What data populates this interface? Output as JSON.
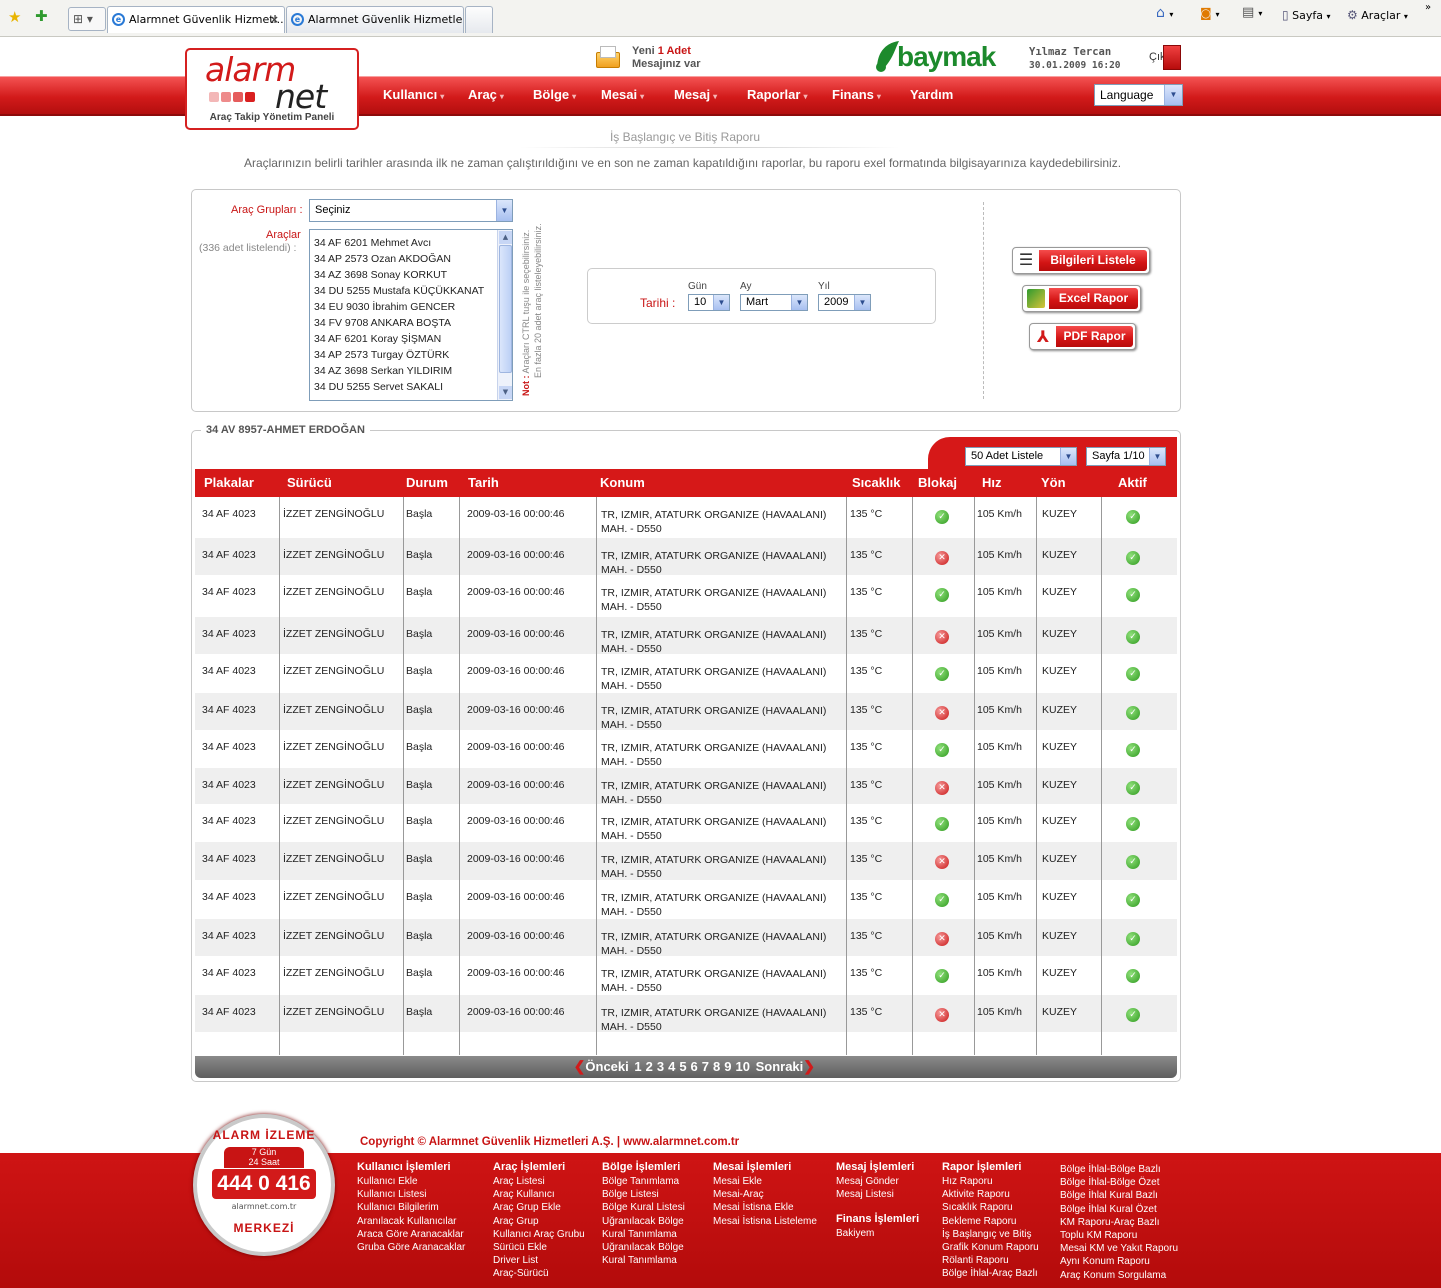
{
  "browser": {
    "tabs": [
      "Alarmnet Güvenlik Hizmetl...",
      "Alarmnet Güvenlik Hizmetleri ..."
    ],
    "toolbar": [
      "Sayfa",
      "Araçlar"
    ]
  },
  "header": {
    "logo_word1": "alarm",
    "logo_word2": "net",
    "logo_sub": "Araç Takip Yönetim Paneli",
    "message_pre": "Yeni ",
    "message_count": "1 Adet",
    "message_post": "Mesajınız var",
    "brand": "baymak",
    "user": "Yılmaz Tercan",
    "datetime": "30.01.2009 16:20",
    "logout": "Çıkış"
  },
  "nav": [
    "Kullanıcı",
    "Araç",
    "Bölge",
    "Mesai",
    "Mesaj",
    "Raporlar",
    "Finans",
    "Yardım"
  ],
  "language": "Language",
  "page": {
    "title": "İş Başlangıç ve Bitiş Raporu",
    "description": "Araçlarınızın belirli tarihler arasında ilk ne zaman çalıştırıldığını ve en son ne zaman kapatıldığını raporlar, bu raporu exel formatında bilgisayarınıza kaydedebilirsiniz."
  },
  "filter": {
    "group_label": "Araç Grupları :",
    "group_value": "Seçiniz",
    "vehicles_label": "Araçlar",
    "vehicles_count": "(336 adet listelendi) :",
    "vehicles": [
      "34 AF 6201 Mehmet Avcı",
      "34 AP 2573 Ozan AKDOĞAN",
      "34 AZ 3698 Sonay KORKUT",
      "34 DU 5255 Mustafa KÜÇÜKKANAT",
      "34 EU 9030 İbrahim GENCER",
      "34 FV 9708 ANKARA BOŞTA",
      "34 AF 6201 Koray ŞİŞMAN",
      "34 AP 2573 Turgay ÖZTÜRK",
      "34 AZ 3698 Serkan YILDIRIM",
      "34 DU 5255 Servet SAKALI"
    ],
    "note_label": "Not :",
    "note_text1": "Araçları CTRL tuşu ile seçebilirsiniz.",
    "note_text2": "En fazla 20 adet araç listeleyebilirsiniz.",
    "date_label": "Tarihi :",
    "day_label": "Gün",
    "month_label": "Ay",
    "year_label": "Yıl",
    "day": "10",
    "month": "Mart",
    "year": "2009",
    "btn_list": "Bilgileri Listele",
    "btn_excel": "Excel Rapor",
    "btn_pdf": "PDF Rapor"
  },
  "grid": {
    "title": "34 AV 8957-AHMET ERDOĞAN",
    "page_size": "50 Adet Listele",
    "page_sel": "Sayfa 1/10",
    "columns": [
      "Plakalar",
      "Sürücü",
      "Durum",
      "Tarih",
      "Konum",
      "Sıcaklık",
      "Blokaj",
      "Hız",
      "Yön",
      "Aktif"
    ],
    "rows": [
      {
        "plaka": "34 AF 4023",
        "surucu": "İZZET ZENGİNOĞLU",
        "durum": "Başla",
        "tarih": "2009-03-16 00:00:46",
        "konum1": "TR, IZMIR, ATATURK ORGANIZE (HAVAALANI)",
        "konum2": "MAH. - D550",
        "sicaklik": "135 °C",
        "blokaj": "ok",
        "hiz": "105 Km/h",
        "yon": "KUZEY",
        "aktif": "ok"
      },
      {
        "plaka": "34 AF 4023",
        "surucu": "İZZET ZENGİNOĞLU",
        "durum": "Başla",
        "tarih": "2009-03-16 00:00:46",
        "konum1": "TR, IZMIR, ATATURK ORGANIZE (HAVAALANI)",
        "konum2": "MAH. - D550",
        "sicaklik": "135 °C",
        "blokaj": "no",
        "hiz": "105 Km/h",
        "yon": "KUZEY",
        "aktif": "ok"
      },
      {
        "plaka": "34 AF 4023",
        "surucu": "İZZET ZENGİNOĞLU",
        "durum": "Başla",
        "tarih": "2009-03-16 00:00:46",
        "konum1": "TR, IZMIR, ATATURK ORGANIZE (HAVAALANI)",
        "konum2": "MAH. - D550",
        "sicaklik": "135 °C",
        "blokaj": "ok",
        "hiz": "105 Km/h",
        "yon": "KUZEY",
        "aktif": "ok"
      },
      {
        "plaka": "34 AF 4023",
        "surucu": "İZZET ZENGİNOĞLU",
        "durum": "Başla",
        "tarih": "2009-03-16 00:00:46",
        "konum1": "TR, IZMIR, ATATURK ORGANIZE (HAVAALANI)",
        "konum2": "MAH. - D550",
        "sicaklik": "135 °C",
        "blokaj": "no",
        "hiz": "105 Km/h",
        "yon": "KUZEY",
        "aktif": "ok"
      },
      {
        "plaka": "34 AF 4023",
        "surucu": "İZZET ZENGİNOĞLU",
        "durum": "Başla",
        "tarih": "2009-03-16 00:00:46",
        "konum1": "TR, IZMIR, ATATURK ORGANIZE (HAVAALANI)",
        "konum2": "MAH. - D550",
        "sicaklik": "135 °C",
        "blokaj": "ok",
        "hiz": "105 Km/h",
        "yon": "KUZEY",
        "aktif": "ok"
      },
      {
        "plaka": "34 AF 4023",
        "surucu": "İZZET ZENGİNOĞLU",
        "durum": "Başla",
        "tarih": "2009-03-16 00:00:46",
        "konum1": "TR, IZMIR, ATATURK ORGANIZE (HAVAALANI)",
        "konum2": "MAH. - D550",
        "sicaklik": "135 °C",
        "blokaj": "no",
        "hiz": "105 Km/h",
        "yon": "KUZEY",
        "aktif": "ok"
      },
      {
        "plaka": "34 AF 4023",
        "surucu": "İZZET ZENGİNOĞLU",
        "durum": "Başla",
        "tarih": "2009-03-16 00:00:46",
        "konum1": "TR, IZMIR, ATATURK ORGANIZE (HAVAALANI)",
        "konum2": "MAH. - D550",
        "sicaklik": "135 °C",
        "blokaj": "ok",
        "hiz": "105 Km/h",
        "yon": "KUZEY",
        "aktif": "ok"
      },
      {
        "plaka": "34 AF 4023",
        "surucu": "İZZET ZENGİNOĞLU",
        "durum": "Başla",
        "tarih": "2009-03-16 00:00:46",
        "konum1": "TR, IZMIR, ATATURK ORGANIZE (HAVAALANI)",
        "konum2": "MAH. - D550",
        "sicaklik": "135 °C",
        "blokaj": "no",
        "hiz": "105 Km/h",
        "yon": "KUZEY",
        "aktif": "ok"
      },
      {
        "plaka": "34 AF 4023",
        "surucu": "İZZET ZENGİNOĞLU",
        "durum": "Başla",
        "tarih": "2009-03-16 00:00:46",
        "konum1": "TR, IZMIR, ATATURK ORGANIZE (HAVAALANI)",
        "konum2": "MAH. - D550",
        "sicaklik": "135 °C",
        "blokaj": "ok",
        "hiz": "105 Km/h",
        "yon": "KUZEY",
        "aktif": "ok"
      },
      {
        "plaka": "34 AF 4023",
        "surucu": "İZZET ZENGİNOĞLU",
        "durum": "Başla",
        "tarih": "2009-03-16 00:00:46",
        "konum1": "TR, IZMIR, ATATURK ORGANIZE (HAVAALANI)",
        "konum2": "MAH. - D550",
        "sicaklik": "135 °C",
        "blokaj": "no",
        "hiz": "105 Km/h",
        "yon": "KUZEY",
        "aktif": "ok"
      },
      {
        "plaka": "34 AF 4023",
        "surucu": "İZZET ZENGİNOĞLU",
        "durum": "Başla",
        "tarih": "2009-03-16 00:00:46",
        "konum1": "TR, IZMIR, ATATURK ORGANIZE (HAVAALANI)",
        "konum2": "MAH. - D550",
        "sicaklik": "135 °C",
        "blokaj": "ok",
        "hiz": "105 Km/h",
        "yon": "KUZEY",
        "aktif": "ok"
      },
      {
        "plaka": "34 AF 4023",
        "surucu": "İZZET ZENGİNOĞLU",
        "durum": "Başla",
        "tarih": "2009-03-16 00:00:46",
        "konum1": "TR, IZMIR, ATATURK ORGANIZE (HAVAALANI)",
        "konum2": "MAH. - D550",
        "sicaklik": "135 °C",
        "blokaj": "no",
        "hiz": "105 Km/h",
        "yon": "KUZEY",
        "aktif": "ok"
      },
      {
        "plaka": "34 AF 4023",
        "surucu": "İZZET ZENGİNOĞLU",
        "durum": "Başla",
        "tarih": "2009-03-16 00:00:46",
        "konum1": "TR, IZMIR, ATATURK ORGANIZE (HAVAALANI)",
        "konum2": "MAH. - D550",
        "sicaklik": "135 °C",
        "blokaj": "ok",
        "hiz": "105 Km/h",
        "yon": "KUZEY",
        "aktif": "ok"
      },
      {
        "plaka": "34 AF 4023",
        "surucu": "İZZET ZENGİNOĞLU",
        "durum": "Başla",
        "tarih": "2009-03-16 00:00:46",
        "konum1": "TR, IZMIR, ATATURK ORGANIZE (HAVAALANI)",
        "konum2": "MAH. - D550",
        "sicaklik": "135 °C",
        "blokaj": "no",
        "hiz": "105 Km/h",
        "yon": "KUZEY",
        "aktif": "ok"
      }
    ],
    "pager": {
      "prev": "Önceki",
      "pages": [
        "1",
        "2",
        "3",
        "4",
        "5",
        "6",
        "7",
        "8",
        "9",
        "10"
      ],
      "next": "Sonraki"
    }
  },
  "footer": {
    "copyright": "Copyright © Alarmnet Güvenlik Hizmetleri A.Ş. | www.alarmnet.com.tr",
    "badge": {
      "top": "ALARM İZLEME",
      "bottom": "MERKEZİ",
      "line1": "7 Gün",
      "line2": "24 Saat",
      "phone": "444 0 416",
      "site": "alarmnet.com.tr"
    },
    "cols": [
      {
        "title": "Kullanıcı İşlemleri",
        "links": [
          "Kullanıcı Ekle",
          "Kullanıcı Listesi",
          "Kullanıcı Bilgilerim",
          "Aranılacak Kullanıcılar",
          "Araca Göre Aranacaklar",
          "Gruba Göre Aranacaklar"
        ]
      },
      {
        "title": "Araç İşlemleri",
        "links": [
          "Araç Listesi",
          "Araç Kullanıcı",
          "Araç Grup Ekle",
          "Araç Grup",
          "Kullanıcı Araç Grubu",
          "Sürücü Ekle",
          "Driver List",
          "Araç-Sürücü"
        ]
      },
      {
        "title": "Bölge İşlemleri",
        "links": [
          "Bölge Tanımlama",
          "Bölge Listesi",
          "Bölge Kural Listesi",
          "Uğranılacak Bölge",
          "Kural Tanımlama",
          "Uğranılacak Bölge",
          "Kural Tanımlama"
        ]
      },
      {
        "title": "Mesai İşlemleri",
        "links": [
          "Mesai Ekle",
          "Mesai-Araç",
          "Mesai İstisna Ekle",
          "Mesai İstisna Listeleme"
        ]
      },
      {
        "title": "Mesaj İşlemleri",
        "links": [
          "Mesaj Gönder",
          "Mesaj Listesi"
        ],
        "title2": "Finans İşlemleri",
        "links2": [
          "Bakiyem"
        ]
      },
      {
        "title": "Rapor İşlemleri",
        "links": [
          "Hız Raporu",
          "Aktivite Raporu",
          "Sıcaklık Raporu",
          "Bekleme Raporu",
          "İş Başlangıç ve Bitiş",
          "Grafik Konum Raporu",
          "Rölanti Raporu",
          "Bölge İhlal-Araç Bazlı"
        ]
      },
      {
        "links": [
          "Bölge İhlal-Bölge Bazlı",
          "Bölge İhlal-Bölge Özet",
          "Bölge İhlal Kural Bazlı",
          "Bölge İhlal Kural Özet",
          "KM Raporu-Araç Bazlı",
          "Toplu KM Raporu",
          "Mesai KM ve Yakıt Raporu",
          "Aynı Konum Raporu",
          "Araç Konum Sorgulama"
        ]
      }
    ]
  }
}
